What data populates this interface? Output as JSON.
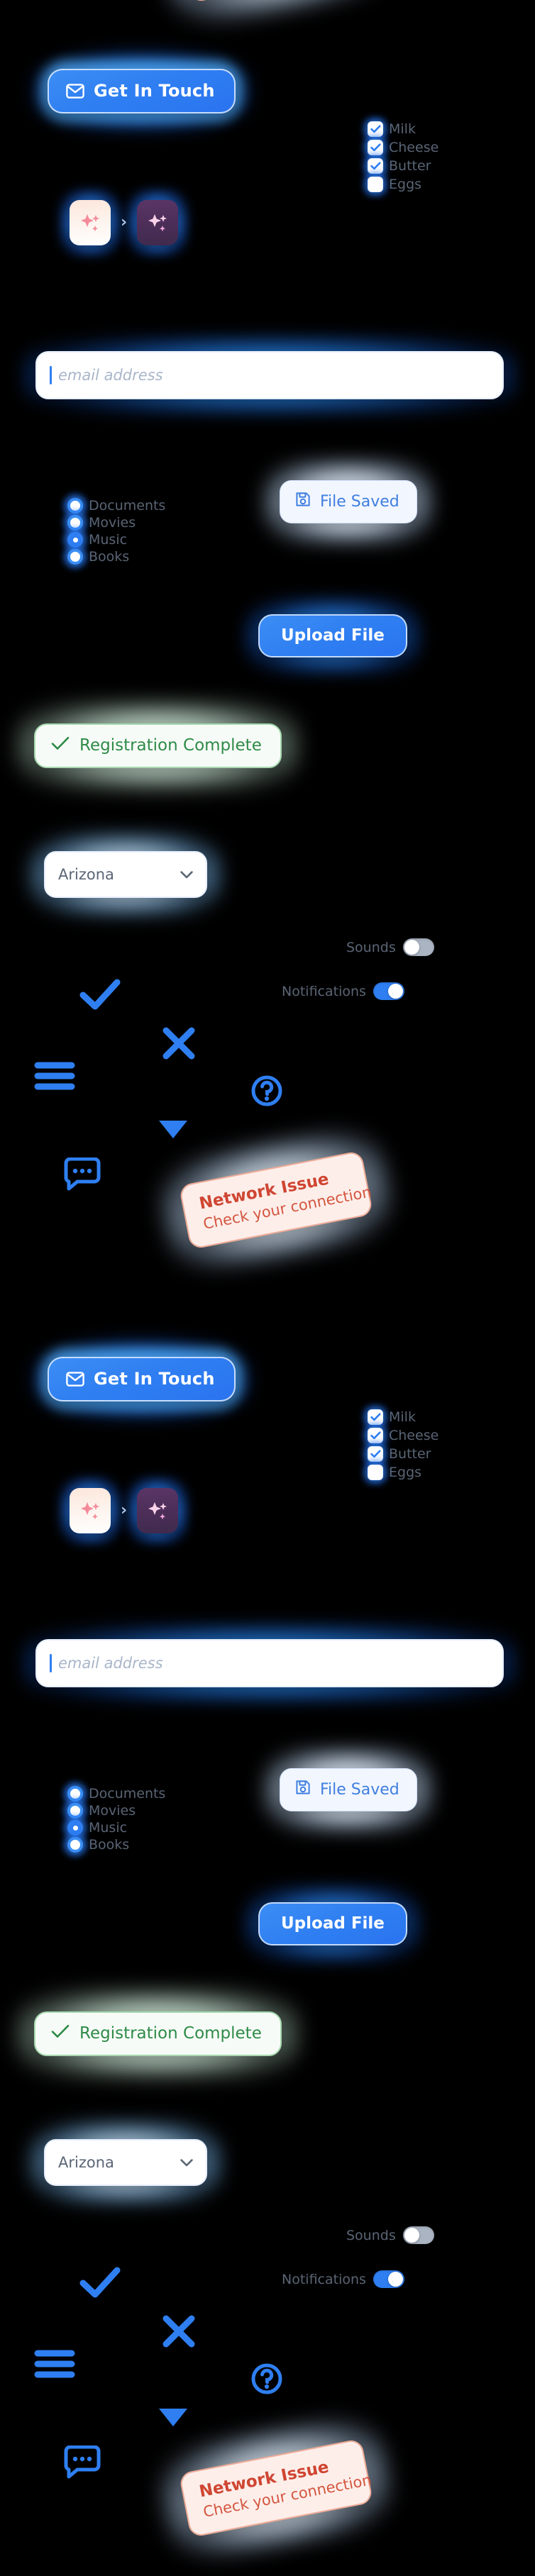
{
  "page": {
    "background_color": "#000000",
    "accent_blue": "#2f7ff2",
    "glow_blue": "#3b96ff",
    "success_green": "#2e8b48",
    "error_red": "#cf4632"
  },
  "contact_button": {
    "label": "Get In Touch",
    "icon": "envelope-icon"
  },
  "checkbox_group": {
    "items": [
      {
        "label": "Milk",
        "checked": true
      },
      {
        "label": "Cheese",
        "checked": true
      },
      {
        "label": "Butter",
        "checked": true
      },
      {
        "label": "Eggs",
        "checked": false
      }
    ]
  },
  "sparkle_pair": {
    "left_icon": "sparkles-icon-light",
    "separator_icon": "chevron-right-icon",
    "right_icon": "sparkles-icon-dark"
  },
  "email_input": {
    "value": "",
    "placeholder": "email address",
    "caret_visible": true
  },
  "radio_group": {
    "items": [
      {
        "label": "Documents",
        "selected": false
      },
      {
        "label": "Movies",
        "selected": false
      },
      {
        "label": "Music",
        "selected": true
      },
      {
        "label": "Books",
        "selected": false
      }
    ]
  },
  "file_saved": {
    "label": "File Saved",
    "icon": "save-icon"
  },
  "upload_button": {
    "label": "Upload File"
  },
  "registration_complete": {
    "label": "Registration Complete",
    "icon": "check-icon"
  },
  "state_select": {
    "value": "Arizona",
    "icon": "chevron-down-icon"
  },
  "toggles": [
    {
      "label": "Sounds",
      "on": false
    },
    {
      "label": "Notifications",
      "on": true
    }
  ],
  "icon_row": {
    "check": "check-icon",
    "close": "close-icon",
    "menu": "hamburger-menu-icon",
    "help": "help-circle-icon",
    "caret": "caret-down-icon",
    "chat": "chat-bubble-icon"
  },
  "network_toast": {
    "title": "Network Issue",
    "subtitle": "Check your connection"
  }
}
